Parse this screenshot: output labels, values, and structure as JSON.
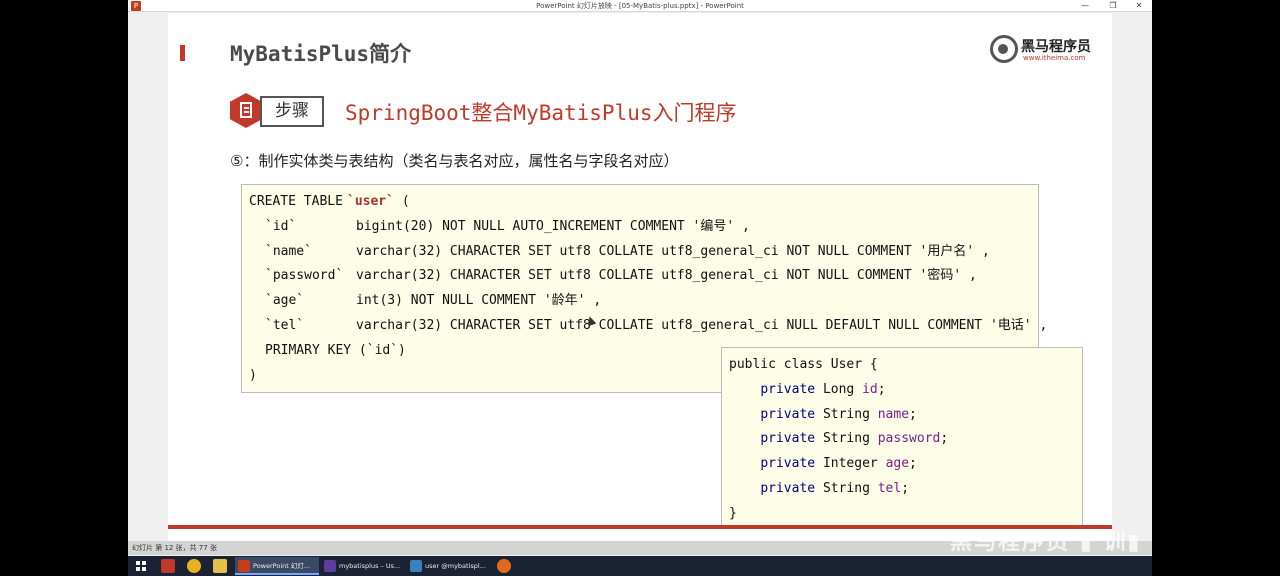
{
  "window": {
    "title": "PowerPoint 幻灯片放映 - [05-MyBatis-plus.pptx] - PowerPoint",
    "app_icon": "P",
    "minimize_glyph": "—",
    "restore_glyph": "❐",
    "close_glyph": "✕"
  },
  "slide": {
    "title": "MyBatisPlus简介",
    "logo_name": "黑马程序员",
    "logo_url": "www.itheima.com",
    "step_label": "步骤",
    "step_title": "SpringBoot整合MyBatisPlus入门程序",
    "subtitle": "⑤：制作实体类与表结构（类名与表名对应，属性名与字段名对应）",
    "sql": {
      "create_prefix": "CREATE TABLE ",
      "table_name": "`user`",
      "create_suffix": " (",
      "rows": [
        {
          "col": "`id`",
          "def": "bigint(20) NOT NULL AUTO_INCREMENT COMMENT '编号' ,"
        },
        {
          "col": "`name`",
          "def": "varchar(32) CHARACTER SET utf8 COLLATE utf8_general_ci NOT NULL COMMENT '用户名' ,"
        },
        {
          "col": "`password`",
          "def": "varchar(32) CHARACTER SET utf8 COLLATE utf8_general_ci NOT NULL COMMENT '密码' ,"
        },
        {
          "col": "`age`",
          "def": "int(3) NOT NULL COMMENT '龄年' ,"
        },
        {
          "col": "`tel`",
          "def": "varchar(32) CHARACTER SET utf8 COLLATE utf8_general_ci NULL DEFAULT NULL COMMENT '电话' ,"
        }
      ],
      "primary_key": "PRIMARY KEY (`id`)",
      "close": ")"
    },
    "java": {
      "class_decl": "public class User {",
      "fields": [
        {
          "modifier": "private",
          "type": "Long",
          "name": "id"
        },
        {
          "modifier": "private",
          "type": "String",
          "name": "name"
        },
        {
          "modifier": "private",
          "type": "String",
          "name": "password"
        },
        {
          "modifier": "private",
          "type": "Integer",
          "name": "age"
        },
        {
          "modifier": "private",
          "type": "String",
          "name": "tel"
        }
      ],
      "close": "}"
    }
  },
  "statusbar": {
    "text": "幻灯片 第 12 张，共 77 张",
    "watermark": "黑马程序员 ▮ 训▮"
  },
  "taskbar": {
    "tasks": [
      {
        "label": "PowerPoint 幻灯...",
        "color": "#c43e1c"
      },
      {
        "label": "mybatisplus – Us...",
        "color": "#5a3fa0"
      },
      {
        "label": "user @mybatispl...",
        "color": "#3a7fc0"
      }
    ]
  }
}
